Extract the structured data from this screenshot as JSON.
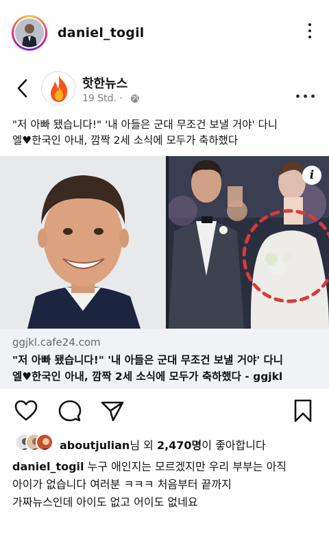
{
  "header": {
    "username": "daniel_togil",
    "more_icon": "more-vertical-icon"
  },
  "embedded_post": {
    "back_icon": "chevron-left-icon",
    "page_name": "핫한뉴스",
    "time": "19 Std. ·",
    "privacy_icon": "globe-icon",
    "more_icon": "more-horizontal-icon",
    "headline_line1": "\"저 아빠 됐습니다!\" '내 아들은 군대 무조건 보낼 거야' 다니",
    "headline_line2": "엘♥한국인 아내, 깜짝 2세 소식에 모두가 축하했다",
    "info_badge": "i",
    "link": {
      "domain": "ggjkl.cafe24.com",
      "title_line1": "\"저 아빠 됐습니다!\" '내 아들은 군대 무조건 보낼 거야' 다니",
      "title_line2": "엘♥한국인 아내, 깜짝 2세 소식에 모두가 축하했다 - ggjkl"
    }
  },
  "actions": {
    "like_icon": "heart-icon",
    "comment_icon": "comment-icon",
    "share_icon": "send-icon",
    "save_icon": "bookmark-icon"
  },
  "likes": {
    "first_liker": "aboutjulian",
    "mid": "님 외 ",
    "count": "2,470명",
    "suffix": "이 좋아합니다"
  },
  "caption": {
    "username": "daniel_togil",
    "line1": " 누구 애인지는 모르겠지만 우리 부부는 아직",
    "line2": "아이가 없습니다 여러분 ㅋㅋㅋ 처음부터 끝까지",
    "line3": "가짜뉴스인데 아이도 없고 어이도 없네요"
  },
  "colors": {
    "link_bg": "#f0f2f5",
    "story_ring": "#ee2a7b",
    "dotted_circle": "#d93a3a"
  }
}
